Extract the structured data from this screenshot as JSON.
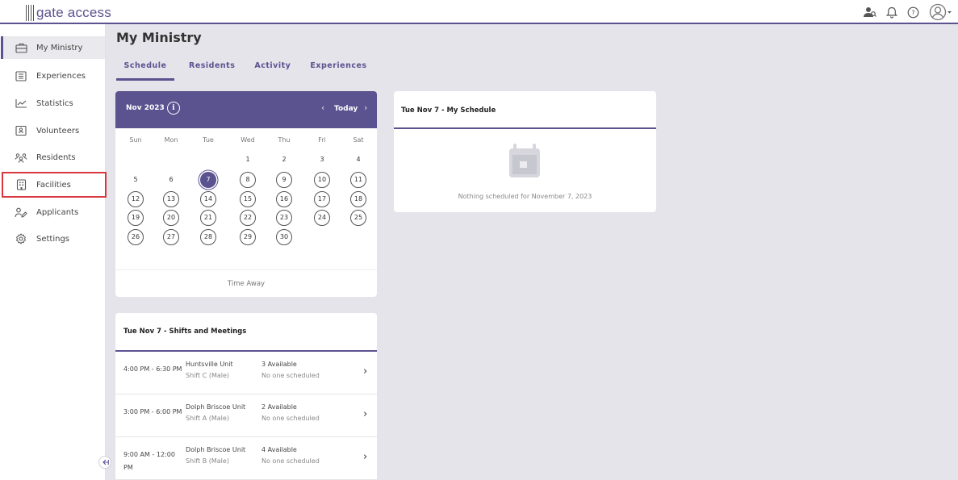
{
  "app": {
    "logo_text": "gate access"
  },
  "topbar": {
    "icons": [
      "user-search-icon",
      "bell-icon",
      "help-icon",
      "avatar-icon"
    ]
  },
  "sidebar": {
    "items": [
      {
        "label": "My Ministry",
        "icon": "briefcase-icon"
      },
      {
        "label": "Experiences",
        "icon": "newspaper-icon"
      },
      {
        "label": "Statistics",
        "icon": "chart-line-icon"
      },
      {
        "label": "Volunteers",
        "icon": "id-badge-icon"
      },
      {
        "label": "Residents",
        "icon": "people-icon"
      },
      {
        "label": "Facilities",
        "icon": "building-icon"
      },
      {
        "label": "Applicants",
        "icon": "person-edit-icon"
      },
      {
        "label": "Settings",
        "icon": "gear-icon"
      }
    ],
    "active_index": 0,
    "highlighted_index": 5
  },
  "header": {
    "title": "My Ministry"
  },
  "tabs": [
    {
      "label": "Schedule",
      "active": true
    },
    {
      "label": "Residents",
      "active": false
    },
    {
      "label": "Activity",
      "active": false
    },
    {
      "label": "Experiences",
      "active": false
    }
  ],
  "calendar": {
    "month_label": "Nov 2023",
    "today_label": "Today",
    "weekdays": [
      "Sun",
      "Mon",
      "Tue",
      "Wed",
      "Thu",
      "Fri",
      "Sat"
    ],
    "days": [
      "1",
      "2",
      "3",
      "4",
      "5",
      "6",
      "7",
      "8",
      "9",
      "10",
      "11",
      "12",
      "13",
      "14",
      "15",
      "16",
      "17",
      "18",
      "19",
      "20",
      "21",
      "22",
      "23",
      "24",
      "25",
      "26",
      "27",
      "28",
      "29",
      "30"
    ],
    "ringed_from": 7,
    "selected_day": "7",
    "footer": "Time Away"
  },
  "shifts": {
    "title": "Tue Nov 7 - Shifts and Meetings",
    "rows": [
      {
        "time": "4:00 PM - 6:30 PM",
        "location": "Huntsville Unit",
        "shift": "Shift C (Male)",
        "available": "3 Available",
        "scheduled": "No one scheduled"
      },
      {
        "time": "3:00 PM - 6:00 PM",
        "location": "Dolph Briscoe Unit",
        "shift": "Shift A (Male)",
        "available": "2 Available",
        "scheduled": "No one scheduled"
      },
      {
        "time": "9:00 AM - 12:00 PM",
        "location": "Dolph Briscoe Unit",
        "shift": "Shift B (Male)",
        "available": "4 Available",
        "scheduled": "No one scheduled"
      }
    ]
  },
  "schedule": {
    "title": "Tue Nov 7 - My Schedule",
    "empty_text": "Nothing scheduled for November 7, 2023"
  },
  "colors": {
    "brand": "#5b5290",
    "highlight": "#d9363e",
    "background": "#e4e4ea"
  }
}
